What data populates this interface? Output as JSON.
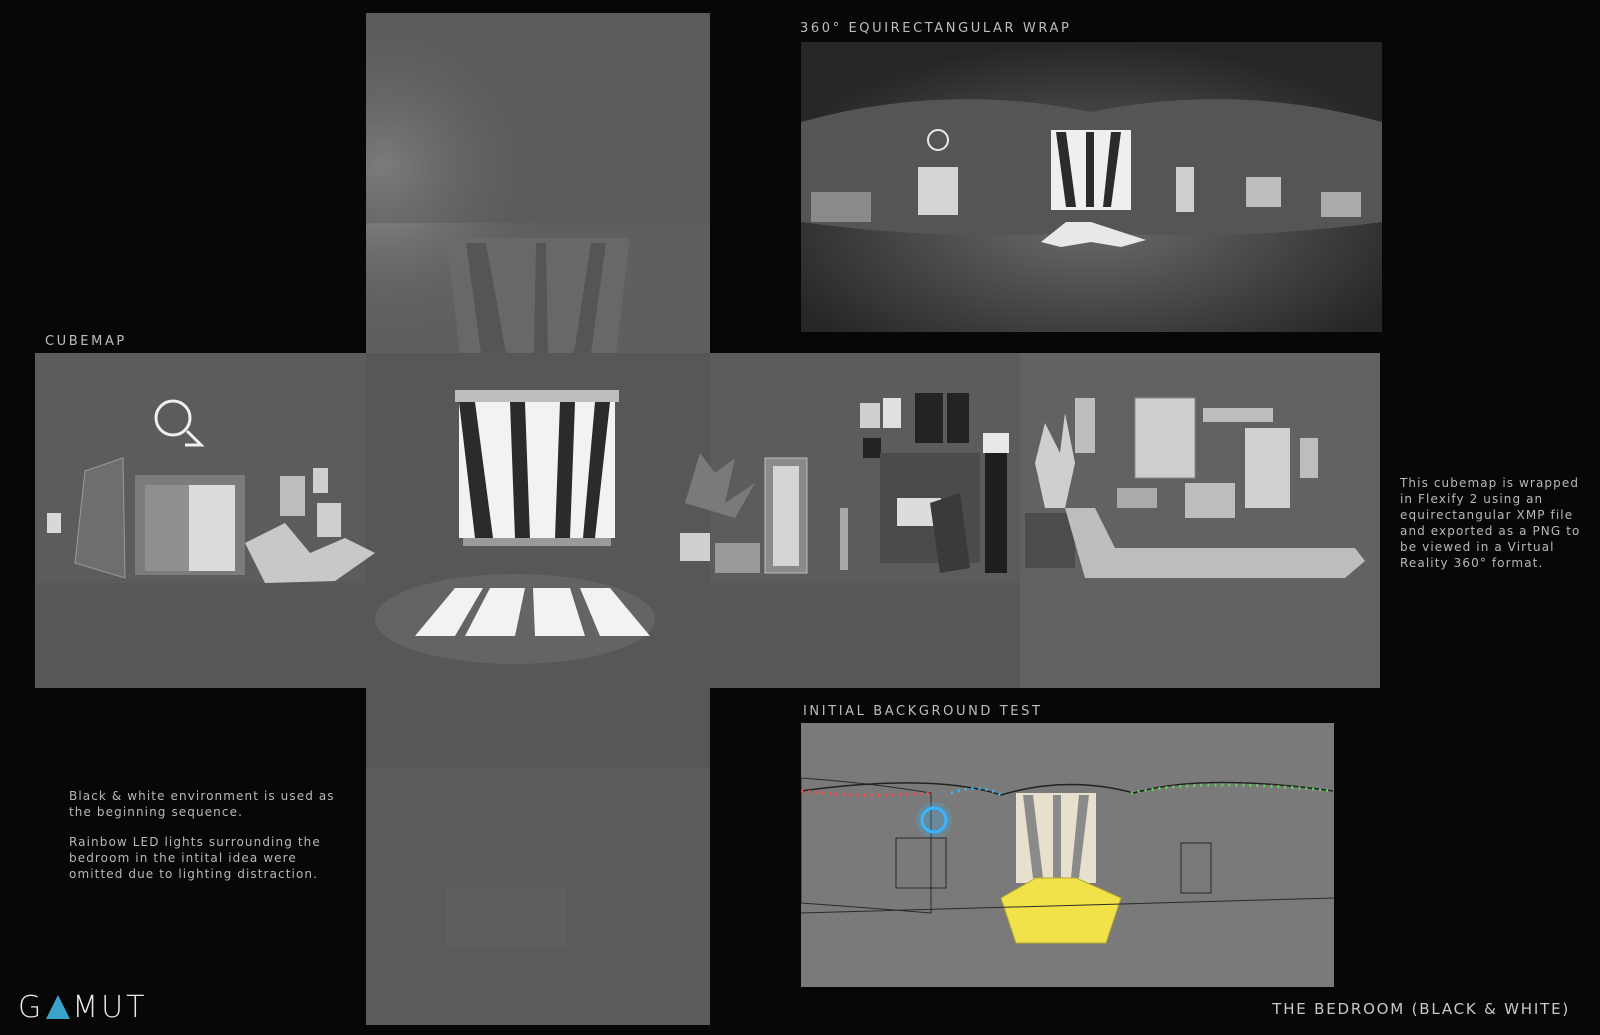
{
  "sections": {
    "cubemap_label": "CUBEMAP",
    "equirect_label": "360° EQUIRECTANGULAR WRAP",
    "initial_test_label": "INITIAL BACKGROUND TEST"
  },
  "notes": {
    "right": "This cubemap is wrapped in Flexify 2 using an equirectangular XMP file and exported as a PNG to be viewed in a Virtual Reality 360° format.",
    "left_p1": "Black & white environment is used as the beginning sequence.",
    "left_p2": "Rainbow LED lights surrounding the bedroom in the intital idea were omitted due to lighting distraction."
  },
  "branding": {
    "logo_left": "G",
    "logo_right": "MUT",
    "title": "THE BEDROOM (BLACK & WHITE)"
  },
  "colors": {
    "background": "#070707",
    "wall": "#5e5e5e",
    "window_light": "#f2f2f2",
    "led_glow_blue": "#38b6ff",
    "window_glow_yellow": "#f2e24a"
  }
}
